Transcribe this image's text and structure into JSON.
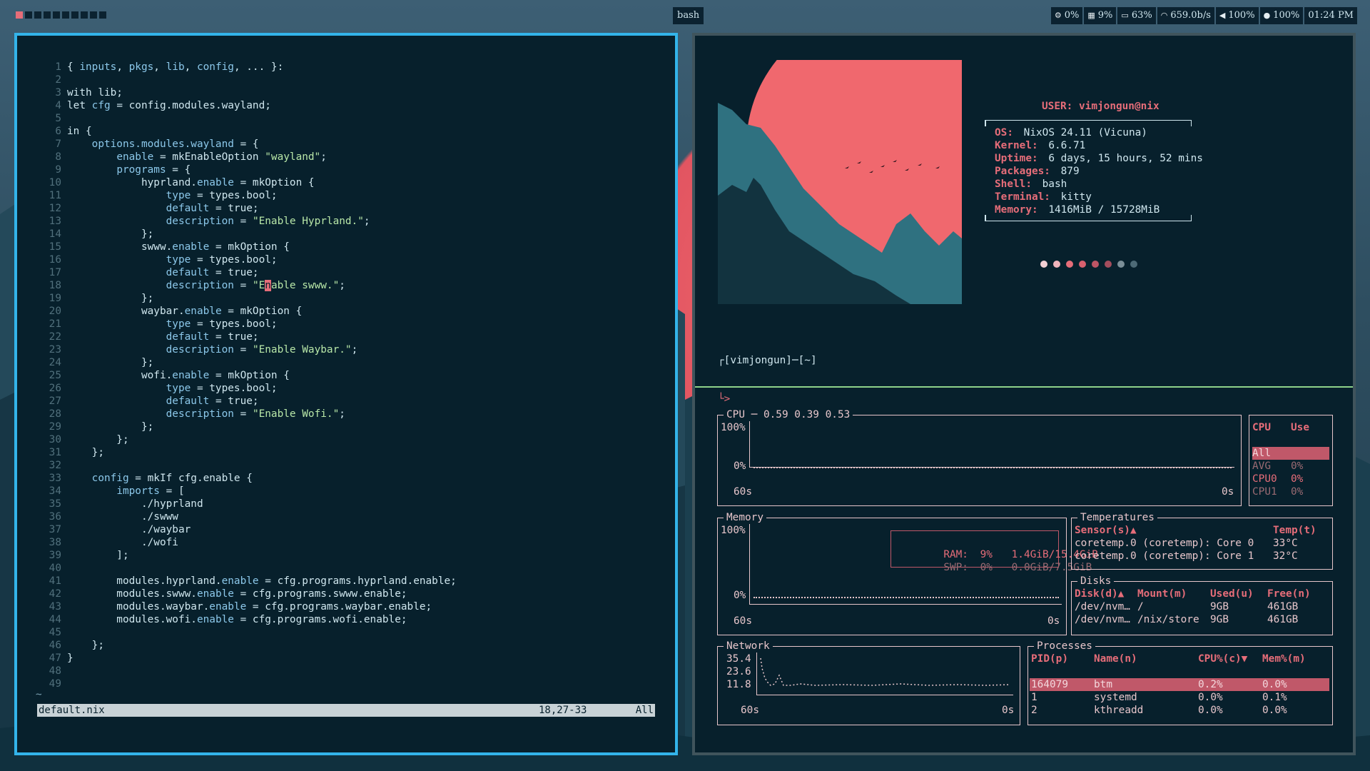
{
  "topbar": {
    "workspace_count": 10,
    "active_workspace": 1,
    "window_title": "bash",
    "modules": [
      {
        "icon": "cpu-gear-icon",
        "glyph": "⚙",
        "text": "0%"
      },
      {
        "icon": "memory-icon",
        "glyph": "▦",
        "text": "9%"
      },
      {
        "icon": "battery-icon",
        "glyph": "▭",
        "text": "63%"
      },
      {
        "icon": "wifi-icon",
        "glyph": "◠",
        "text": "659.0b/s"
      },
      {
        "icon": "volume-icon",
        "glyph": "◀",
        "text": "100%"
      },
      {
        "icon": "brightness-icon",
        "glyph": "●",
        "text": "100%"
      },
      {
        "icon": "clock-icon",
        "glyph": "",
        "text": "01:24 PM"
      }
    ]
  },
  "editor": {
    "lines": [
      [
        [
          "k",
          "{ "
        ],
        [
          "b",
          "inputs"
        ],
        [
          "k",
          ", "
        ],
        [
          "b",
          "pkgs"
        ],
        [
          "k",
          ", "
        ],
        [
          "b",
          "lib"
        ],
        [
          "k",
          ", "
        ],
        [
          "b",
          "config"
        ],
        [
          "k",
          ", ... }:"
        ]
      ],
      [],
      [
        [
          "k",
          "with lib;"
        ]
      ],
      [
        [
          "k",
          "let "
        ],
        [
          "b",
          "cfg"
        ],
        [
          "k",
          " = config.modules.wayland;"
        ]
      ],
      [],
      [
        [
          "k",
          "in {"
        ]
      ],
      [
        [
          "k",
          "    "
        ],
        [
          "b",
          "options.modules.wayland"
        ],
        [
          "k",
          " = {"
        ]
      ],
      [
        [
          "k",
          "        "
        ],
        [
          "b",
          "enable"
        ],
        [
          "k",
          " = mkEnableOption "
        ],
        [
          "s",
          "\"wayland\""
        ],
        [
          "k",
          ";"
        ]
      ],
      [
        [
          "k",
          "        "
        ],
        [
          "b",
          "programs"
        ],
        [
          "k",
          " = {"
        ]
      ],
      [
        [
          "k",
          "            "
        ],
        [
          "k",
          "hyprland."
        ],
        [
          "b",
          "enable"
        ],
        [
          "k",
          " = mkOption {"
        ]
      ],
      [
        [
          "k",
          "                "
        ],
        [
          "b",
          "type"
        ],
        [
          "k",
          " = types.bool;"
        ]
      ],
      [
        [
          "k",
          "                "
        ],
        [
          "b",
          "default"
        ],
        [
          "k",
          " = true;"
        ]
      ],
      [
        [
          "k",
          "                "
        ],
        [
          "b",
          "description"
        ],
        [
          "k",
          " = "
        ],
        [
          "s",
          "\"Enable Hyprland.\""
        ],
        [
          "k",
          ";"
        ]
      ],
      [
        [
          "k",
          "            };"
        ]
      ],
      [
        [
          "k",
          "            "
        ],
        [
          "k",
          "swww."
        ],
        [
          "b",
          "enable"
        ],
        [
          "k",
          " = mkOption {"
        ]
      ],
      [
        [
          "k",
          "                "
        ],
        [
          "b",
          "type"
        ],
        [
          "k",
          " = types.bool;"
        ]
      ],
      [
        [
          "k",
          "                "
        ],
        [
          "b",
          "default"
        ],
        [
          "k",
          " = true;"
        ]
      ],
      [
        [
          "k",
          "                "
        ],
        [
          "b",
          "description"
        ],
        [
          "k",
          " = "
        ],
        [
          "s",
          "\"E"
        ],
        [
          "cursor",
          "n"
        ],
        [
          "s",
          "able swww.\""
        ],
        [
          "k",
          ";"
        ]
      ],
      [
        [
          "k",
          "            };"
        ]
      ],
      [
        [
          "k",
          "            "
        ],
        [
          "k",
          "waybar."
        ],
        [
          "b",
          "enable"
        ],
        [
          "k",
          " = mkOption {"
        ]
      ],
      [
        [
          "k",
          "                "
        ],
        [
          "b",
          "type"
        ],
        [
          "k",
          " = types.bool;"
        ]
      ],
      [
        [
          "k",
          "                "
        ],
        [
          "b",
          "default"
        ],
        [
          "k",
          " = true;"
        ]
      ],
      [
        [
          "k",
          "                "
        ],
        [
          "b",
          "description"
        ],
        [
          "k",
          " = "
        ],
        [
          "s",
          "\"Enable Waybar.\""
        ],
        [
          "k",
          ";"
        ]
      ],
      [
        [
          "k",
          "            };"
        ]
      ],
      [
        [
          "k",
          "            "
        ],
        [
          "k",
          "wofi."
        ],
        [
          "b",
          "enable"
        ],
        [
          "k",
          " = mkOption {"
        ]
      ],
      [
        [
          "k",
          "                "
        ],
        [
          "b",
          "type"
        ],
        [
          "k",
          " = types.bool;"
        ]
      ],
      [
        [
          "k",
          "                "
        ],
        [
          "b",
          "default"
        ],
        [
          "k",
          " = true;"
        ]
      ],
      [
        [
          "k",
          "                "
        ],
        [
          "b",
          "description"
        ],
        [
          "k",
          " = "
        ],
        [
          "s",
          "\"Enable Wofi.\""
        ],
        [
          "k",
          ";"
        ]
      ],
      [
        [
          "k",
          "            };"
        ]
      ],
      [
        [
          "k",
          "        };"
        ]
      ],
      [
        [
          "k",
          "    };"
        ]
      ],
      [],
      [
        [
          "k",
          "    "
        ],
        [
          "b",
          "config"
        ],
        [
          "k",
          " = mkIf cfg.enable {"
        ]
      ],
      [
        [
          "k",
          "        "
        ],
        [
          "b",
          "imports"
        ],
        [
          "k",
          " = ["
        ]
      ],
      [
        [
          "k",
          "            ./hyprland"
        ]
      ],
      [
        [
          "k",
          "            ./swww"
        ]
      ],
      [
        [
          "k",
          "            ./waybar"
        ]
      ],
      [
        [
          "k",
          "            ./wofi"
        ]
      ],
      [
        [
          "k",
          "        ];"
        ]
      ],
      [],
      [
        [
          "k",
          "        modules.hyprland."
        ],
        [
          "b",
          "enable"
        ],
        [
          "k",
          " = cfg.programs.hyprland.enable;"
        ]
      ],
      [
        [
          "k",
          "        modules.swww."
        ],
        [
          "b",
          "enable"
        ],
        [
          "k",
          " = cfg.programs.swww.enable;"
        ]
      ],
      [
        [
          "k",
          "        modules.waybar."
        ],
        [
          "b",
          "enable"
        ],
        [
          "k",
          " = cfg.programs.waybar.enable;"
        ]
      ],
      [
        [
          "k",
          "        modules.wofi."
        ],
        [
          "b",
          "enable"
        ],
        [
          "k",
          " = cfg.programs.wofi.enable;"
        ]
      ],
      [],
      [
        [
          "k",
          "    };"
        ]
      ],
      [
        [
          "k",
          "}"
        ]
      ],
      [],
      []
    ],
    "tilde": "~",
    "status_file": "default.nix",
    "status_pos": "18,27-33",
    "status_all": "All"
  },
  "fetch": {
    "user_label": "USER:",
    "user_value": "vimjongun@nix",
    "rows": [
      {
        "label": "OS:",
        "value": "NixOS 24.11 (Vicuna)"
      },
      {
        "label": "Kernel:",
        "value": "6.6.71"
      },
      {
        "label": "Uptime:",
        "value": "6 days, 15 hours, 52 mins"
      },
      {
        "label": "Packages:",
        "value": "879"
      },
      {
        "label": "Shell:",
        "value": "bash"
      },
      {
        "label": "Terminal:",
        "value": "kitty"
      },
      {
        "label": "Memory:",
        "value": "1416MiB / 15728MiB"
      }
    ],
    "dot_colors": [
      "#f3d0d5",
      "#f0b4bc",
      "#e66d79",
      "#d9606e",
      "#bd5565",
      "#a34d5d",
      "#7b8f98",
      "#4d6a76"
    ],
    "prompt_line1": "┌[vimjongun]─[~]",
    "prompt_line2": "└>"
  },
  "btm": {
    "cpu": {
      "title": "CPU ─ 0.59 0.39 0.53",
      "y_top": "100%",
      "y_bottom": "0%",
      "x_left": "60s",
      "x_right": "0s",
      "legend_header_cpu": "CPU",
      "legend_header_use": "Use",
      "legend_rows": [
        {
          "name": "All",
          "use": "",
          "style": "hl"
        },
        {
          "name": "AVG",
          "use": "0%",
          "style": "dim"
        },
        {
          "name": "CPU0",
          "use": "0%",
          "style": "pink"
        },
        {
          "name": "CPU1",
          "use": "0%",
          "style": "dim"
        }
      ]
    },
    "memory": {
      "title": "Memory",
      "y_top": "100%",
      "y_bottom": "0%",
      "x_left": "60s",
      "x_right": "0s",
      "ram_label": "RAM:",
      "ram_pct": "9%",
      "ram_val": "1.4GiB/15.4GiB",
      "swp_label": "SWP:",
      "swp_pct": "0%",
      "swp_val": "0.0GiB/7.5GiB"
    },
    "temps": {
      "title": "Temperatures",
      "h_sensor": "Sensor(s)▲",
      "h_temp": "Temp(t)",
      "rows": [
        {
          "sensor": "coretemp.0 (coretemp): Core 0",
          "temp": "33°C"
        },
        {
          "sensor": "coretemp.0 (coretemp): Core 1",
          "temp": "32°C"
        }
      ]
    },
    "disks": {
      "title": "Disks",
      "headers": [
        "Disk(d)▲",
        "Mount(m)",
        "Used(u)",
        "Free(n)"
      ],
      "rows": [
        [
          "/dev/nvm…",
          "/",
          "9GB",
          "461GB"
        ],
        [
          "/dev/nvm…",
          "/nix/store",
          "9GB",
          "461GB"
        ]
      ]
    },
    "network": {
      "title": "Network",
      "y_labels": [
        "35.4",
        "23.6",
        "11.8"
      ],
      "x_left": "60s",
      "x_right": "0s"
    },
    "processes": {
      "title": "Processes",
      "headers": [
        "PID(p)",
        "Name(n)",
        "CPU%(c)▼",
        "Mem%(m)"
      ],
      "rows": [
        [
          "164079",
          "btm",
          "0.2%",
          "0.0%"
        ],
        [
          "1",
          "systemd",
          "0.0%",
          "0.1%"
        ],
        [
          "2",
          "kthreadd",
          "0.0%",
          "0.0%"
        ]
      ]
    }
  }
}
